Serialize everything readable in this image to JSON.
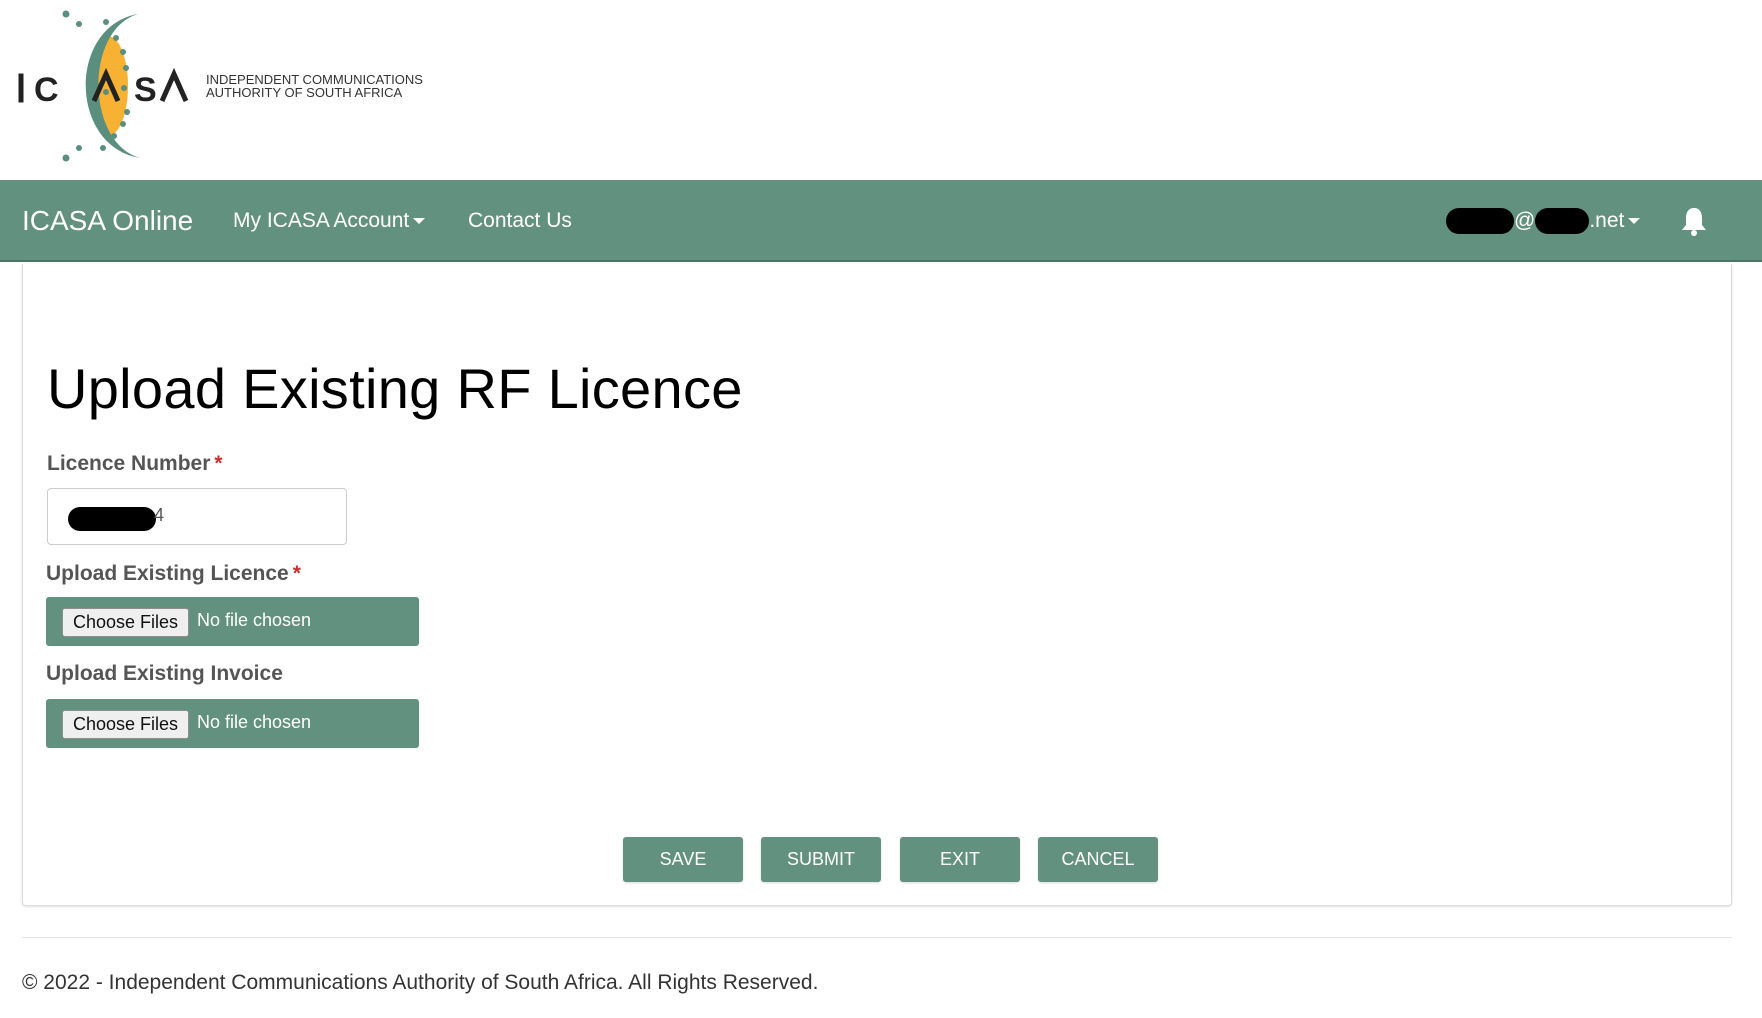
{
  "header": {
    "logo_text": "ICASA",
    "logo_tagline_line1": "INDEPENDENT COMMUNICATIONS",
    "logo_tagline_line2": "AUTHORITY OF SOUTH AFRICA"
  },
  "navbar": {
    "brand": "ICASA Online",
    "items": [
      {
        "label": "My ICASA Account",
        "has_dropdown": true
      },
      {
        "label": "Contact Us",
        "has_dropdown": false
      }
    ],
    "user": {
      "at": "@",
      "suffix": ".net",
      "redacted": true
    },
    "notification_icon": "bell-icon",
    "background_color": "#63917f"
  },
  "form": {
    "title": "Upload Existing RF Licence",
    "licence_number": {
      "label": "Licence Number",
      "required_marker": "*",
      "value_tail": "4",
      "value_redacted": true
    },
    "upload_licence": {
      "label": "Upload Existing Licence",
      "required_marker": "*",
      "button_label": "Choose Files",
      "status": "No file chosen"
    },
    "upload_invoice": {
      "label": "Upload Existing Invoice",
      "button_label": "Choose Files",
      "status": "No file chosen"
    },
    "actions": {
      "save": "SAVE",
      "submit": "SUBMIT",
      "exit": "EXIT",
      "cancel": "CANCEL"
    }
  },
  "footer": {
    "copyright": "© 2022 - Independent Communications Authority of South Africa. All Rights Reserved."
  },
  "colors": {
    "accent": "#63917f",
    "required": "#c9302c",
    "logo_orange": "#f7b233",
    "logo_teal": "#5a8f80"
  }
}
